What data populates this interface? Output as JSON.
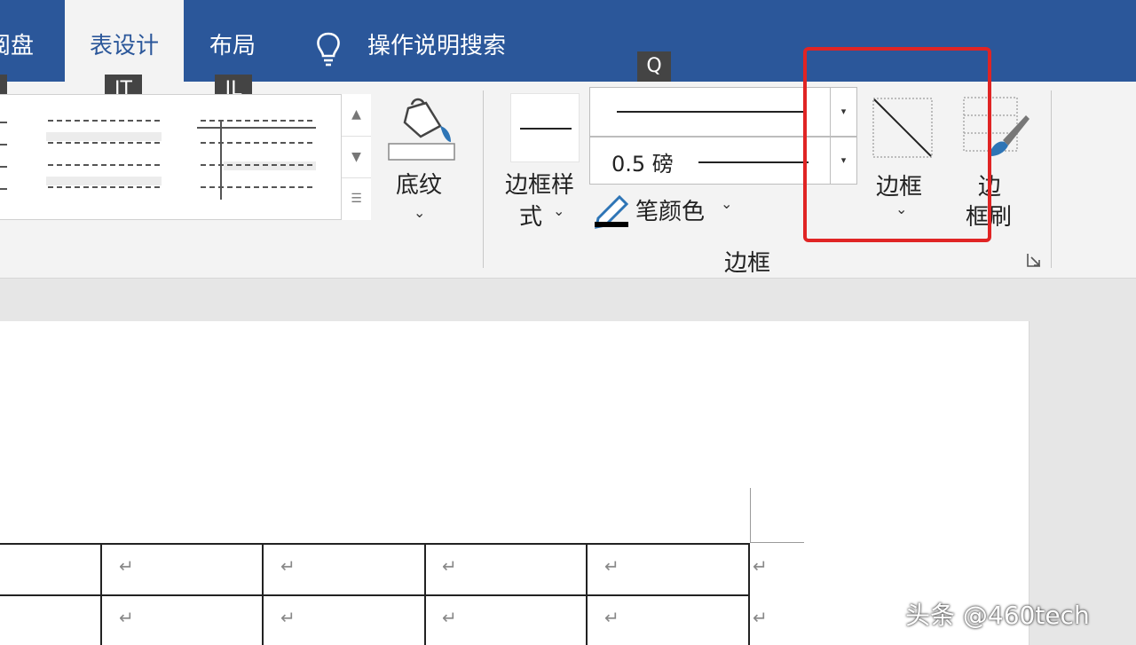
{
  "tabs": {
    "mailings_partial": "阅盘",
    "table_design": "表设计",
    "layout": "布局",
    "tell_me": "操作说明搜索"
  },
  "keytips": {
    "table_design": "JT",
    "layout": "JL",
    "tell_me": "Q"
  },
  "ribbon": {
    "shading_label": "底纹",
    "border_styles_line1": "边框样",
    "border_styles_line2": "式",
    "pen_weight_value": "0.5 磅",
    "pen_color_label": "笔颜色",
    "borders_label": "边框",
    "border_painter_line1": "边",
    "border_painter_line2": "框刷",
    "group_label": "边框",
    "highlight_color": "#e02424"
  },
  "colors": {
    "title_bar": "#2b579a",
    "ribbon_bg": "#f3f3f3",
    "pen_color": "#000000"
  },
  "watermark": "头条 @460tech"
}
